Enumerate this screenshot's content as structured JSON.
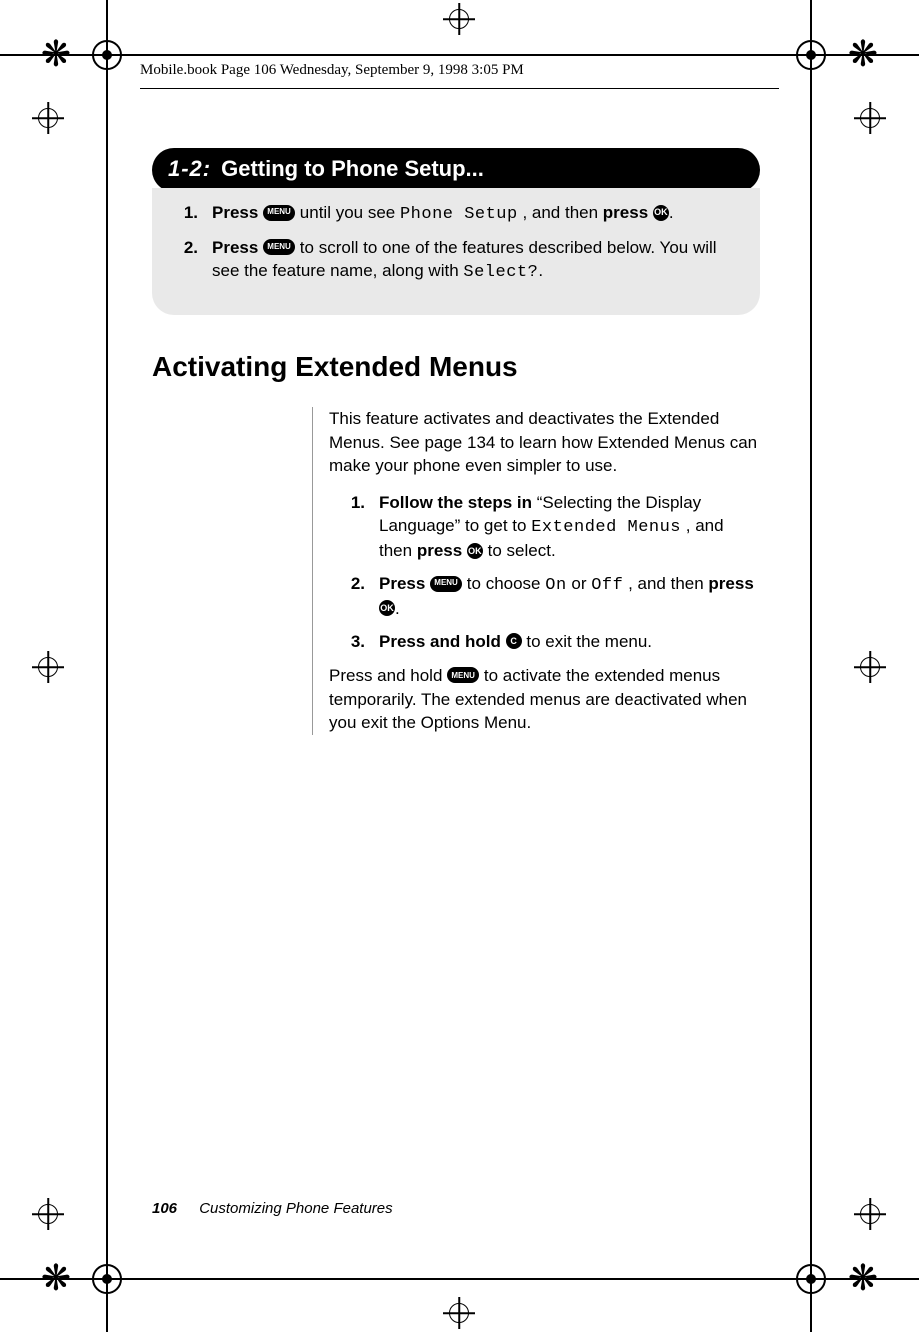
{
  "running_head": "Mobile.book  Page 106  Wednesday, September 9, 1998  3:05 PM",
  "banner": {
    "number": "1-2:",
    "title": "Getting to Phone Setup..."
  },
  "box_steps": [
    {
      "n": "1.",
      "prefix_bold": "Press",
      "key1": "MENU",
      "mid1": " until you see ",
      "lcd1": "Phone Setup",
      "mid2": ", and then ",
      "bold2": "press",
      "key2": "OK",
      "suffix": "."
    },
    {
      "n": "2.",
      "prefix_bold": "Press",
      "key1": "MENU",
      "mid1": " to scroll to one of the features described below. You will see the feature name, along with ",
      "lcd1": "Select?",
      "suffix": "."
    }
  ],
  "section_heading": "Activating Extended Menus",
  "intro_para": "This feature activates and deactivates the Extended Menus. See page 134 to learn how Extended Menus can make your phone even simpler to use.",
  "body_steps": [
    {
      "n": "1.",
      "bold": "Follow the steps in",
      "mid1": " “Selecting the Display Language” to get to ",
      "lcd1": "Extended Menus",
      "mid2": ", and then ",
      "bold2": "press",
      "key2": "OK",
      "suffix": " to select."
    },
    {
      "n": "2.",
      "bold": "Press",
      "key1": "MENU",
      "mid1": " to choose ",
      "lcd1": "On",
      "mid2": " or ",
      "lcd2": "Off",
      "mid3": ", and then ",
      "bold2": "press",
      "key2": "OK",
      "suffix": "."
    },
    {
      "n": "3.",
      "bold": "Press and hold",
      "key1": "C",
      "mid1": " to exit the menu."
    }
  ],
  "tail_para_pre": "Press and hold ",
  "tail_para_key": "MENU",
  "tail_para_post": " to activate the extended menus temporarily. The extended menus are deactivated when you exit the Options Menu.",
  "footer": {
    "page": "106",
    "chapter": "Customizing Phone Features"
  },
  "icons": {
    "menu": "MENU",
    "ok": "OK",
    "c": "C"
  }
}
